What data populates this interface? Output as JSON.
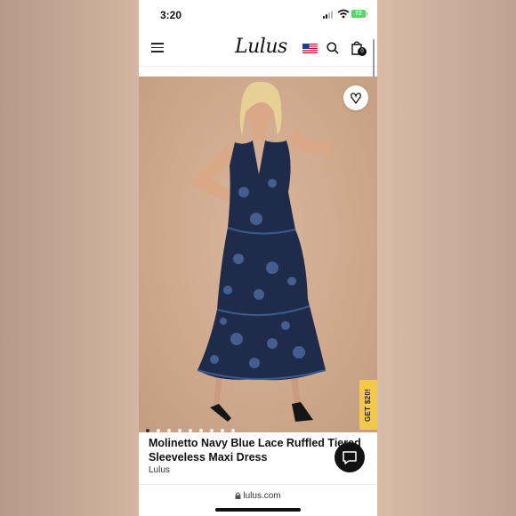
{
  "status_bar": {
    "time": "3:20",
    "battery": "72"
  },
  "header": {
    "logo": "Lulus",
    "cart_count": "0"
  },
  "gallery": {
    "dot_count": 9,
    "active_index": 0
  },
  "promo": {
    "label": "GET $20!"
  },
  "product": {
    "title": "Molinetto Navy Blue Lace Ruffled Tiered Sleeveless Maxi Dress",
    "brand": "Lulus"
  },
  "browser": {
    "url": "lulus.com"
  },
  "icons": {
    "menu": "hamburger-menu-icon",
    "flag": "us-flag-icon",
    "search": "search-icon",
    "bag": "shopping-bag-icon",
    "wishlist": "heart-icon",
    "chat": "chat-icon",
    "lock": "lock-icon"
  },
  "colors": {
    "promo": "#f2c94c",
    "dress": "#1e2a48",
    "background": "#d4b39a"
  }
}
